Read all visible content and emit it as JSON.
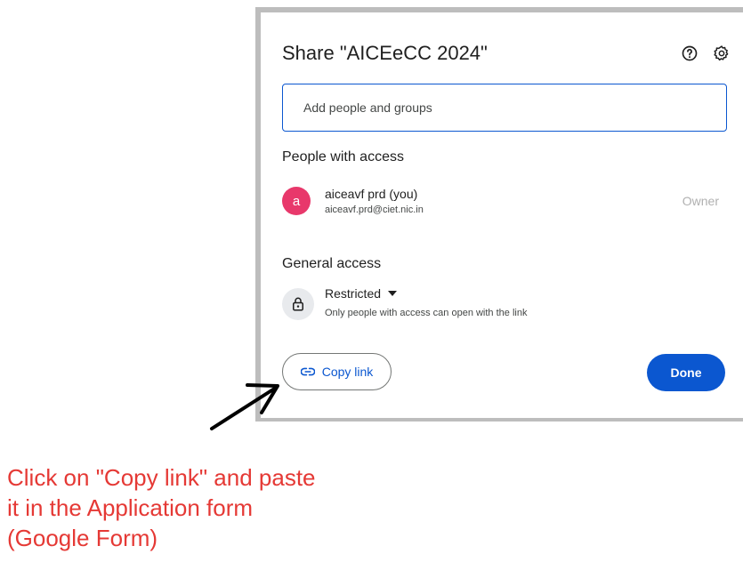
{
  "dialog": {
    "title": "Share \"AICEeCC 2024\"",
    "help_icon": "help-circle-icon",
    "settings_icon": "gear-icon",
    "add_people_placeholder": "Add people and groups",
    "people_heading": "People with access",
    "owner": {
      "avatar_letter": "a",
      "avatar_color": "#e8386b",
      "name": "aiceavf prd (you)",
      "email": "aiceavf.prd@ciet.nic.in",
      "role": "Owner"
    },
    "general_heading": "General access",
    "general_access": {
      "value": "Restricted",
      "description": "Only people with access can open with the link",
      "icon": "lock-icon"
    },
    "copy_link_label": "Copy link",
    "copy_link_icon": "link-icon",
    "done_label": "Done"
  },
  "colors": {
    "accent": "#0b57d0",
    "annotation": "#e53935"
  },
  "annotation": {
    "lines": [
      "Click on \"Copy link\" and paste",
      "it in the Application form",
      "(Google Form)"
    ]
  }
}
